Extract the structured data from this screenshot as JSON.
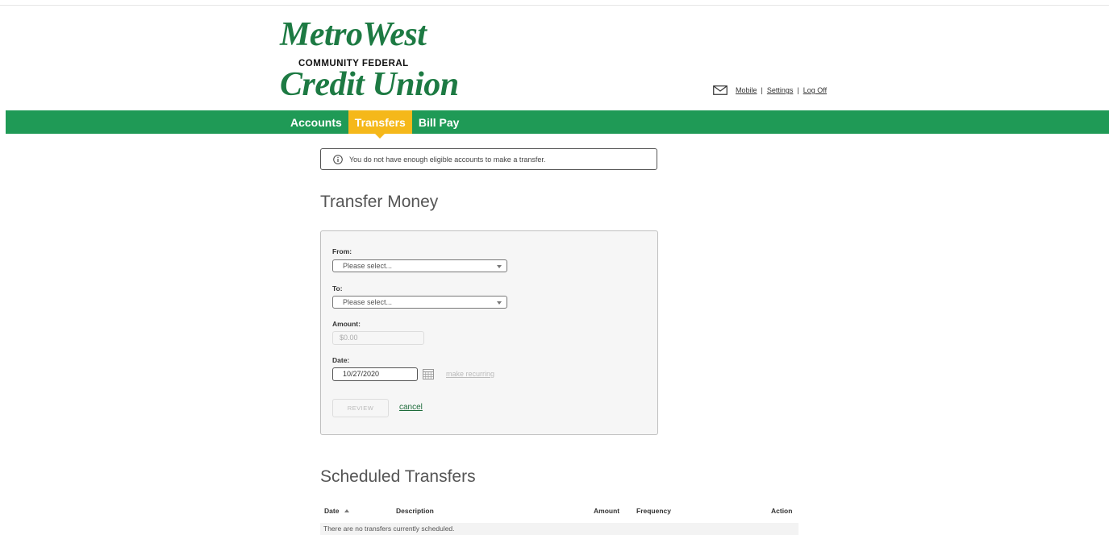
{
  "logo": {
    "line1": "MetroWest",
    "line2": "COMMUNITY FEDERAL",
    "line3": "Credit Union"
  },
  "utility": {
    "mail_icon": "envelope-icon",
    "mobile": "Mobile",
    "settings": "Settings",
    "logoff": "Log Off",
    "separator": "|"
  },
  "nav": {
    "accounts": "Accounts",
    "transfers": "Transfers",
    "billpay": "Bill Pay",
    "active": "Transfers"
  },
  "alert": {
    "icon": "info-icon",
    "text": "You do not have enough eligible accounts to make a transfer."
  },
  "transfer": {
    "title": "Transfer Money",
    "from_label": "From:",
    "from_value": "Please select...",
    "to_label": "To:",
    "to_value": "Please select...",
    "amount_label": "Amount:",
    "amount_placeholder": "$0.00",
    "date_label": "Date:",
    "date_value": "10/27/2020",
    "calendar_icon": "calendar-icon",
    "recurring": "make recurring",
    "review": "REVIEW",
    "cancel": "cancel"
  },
  "scheduled": {
    "title": "Scheduled Transfers",
    "columns": [
      "Date",
      "Description",
      "Amount",
      "Frequency",
      "Action"
    ],
    "empty_message": "There are no transfers currently scheduled."
  },
  "colors": {
    "brand_green": "#1f9a56",
    "logo_green": "#1d7a43",
    "active_tab": "#f5b81a"
  }
}
